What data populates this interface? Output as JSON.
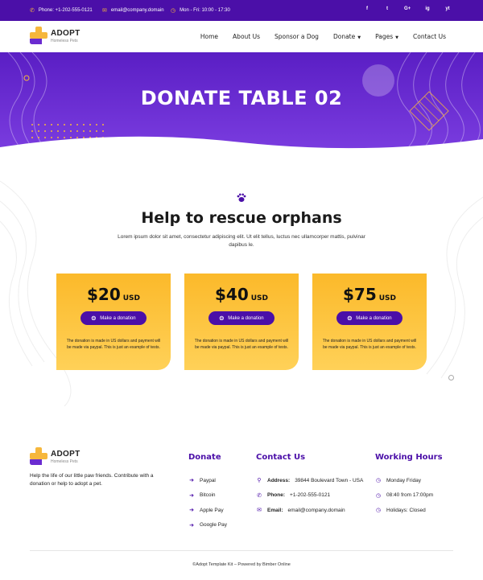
{
  "topbar": {
    "phone": "Phone: +1-202-555-0121",
    "email": "email@company.domain",
    "hours": "Mon - Fri: 10:00 - 17:30",
    "social": [
      "f",
      "t",
      "G+",
      "ig",
      "yt"
    ]
  },
  "brand": {
    "name": "ADOPT",
    "tagline": "Homeless Pets"
  },
  "nav": {
    "items": [
      "Home",
      "About Us",
      "Sponsor a Dog",
      "Donate",
      "Pages",
      "Contact Us"
    ]
  },
  "hero": {
    "title": "DONATE TABLE 02"
  },
  "section": {
    "title": "Help to rescue orphans",
    "description": "Lorem ipsum dolor sit amet, consectetur adipiscing elit. Ut elit tellus, luctus nec ullamcorper mattis, pulvinar dapibus le."
  },
  "cards": [
    {
      "amount": "$20",
      "currency": "USD",
      "button": "Make a donation",
      "note": "The donation is made in US dollars and payment will be made via paypal. This is just an example of tests."
    },
    {
      "amount": "$40",
      "currency": "USD",
      "button": "Make a donation",
      "note": "The donation is made in US dollars and payment will be made via paypal. This is just an example of tests."
    },
    {
      "amount": "$75",
      "currency": "USD",
      "button": "Make a donation",
      "note": "The donation is made in US dollars and payment will be made via paypal. This is just an example of tests."
    }
  ],
  "footer": {
    "about": "Help the life of our little paw friends. Contribute with a donation or help to adopt a pet.",
    "donate": {
      "title": "Donate",
      "items": [
        "Paypal",
        "Bitcoin",
        "Apple Pay",
        "Google Pay"
      ]
    },
    "contact": {
      "title": "Contact Us",
      "address_label": "Address:",
      "address": "39844 Boulevard Town - USA",
      "phone_label": "Phone:",
      "phone": "+1-202-555-0121",
      "email_label": "Email:",
      "email": "email@company.domain"
    },
    "hours": {
      "title": "Working Hours",
      "items": [
        "Monday Friday",
        "08:40 from 17:00pm",
        "Holidays: Closed"
      ]
    },
    "copyright": "©Adopt Template Kit – Powered by Bimber Online"
  },
  "colors": {
    "primary": "#4b0fa8",
    "accent": "#f6b73c",
    "card": "#ffc940"
  }
}
